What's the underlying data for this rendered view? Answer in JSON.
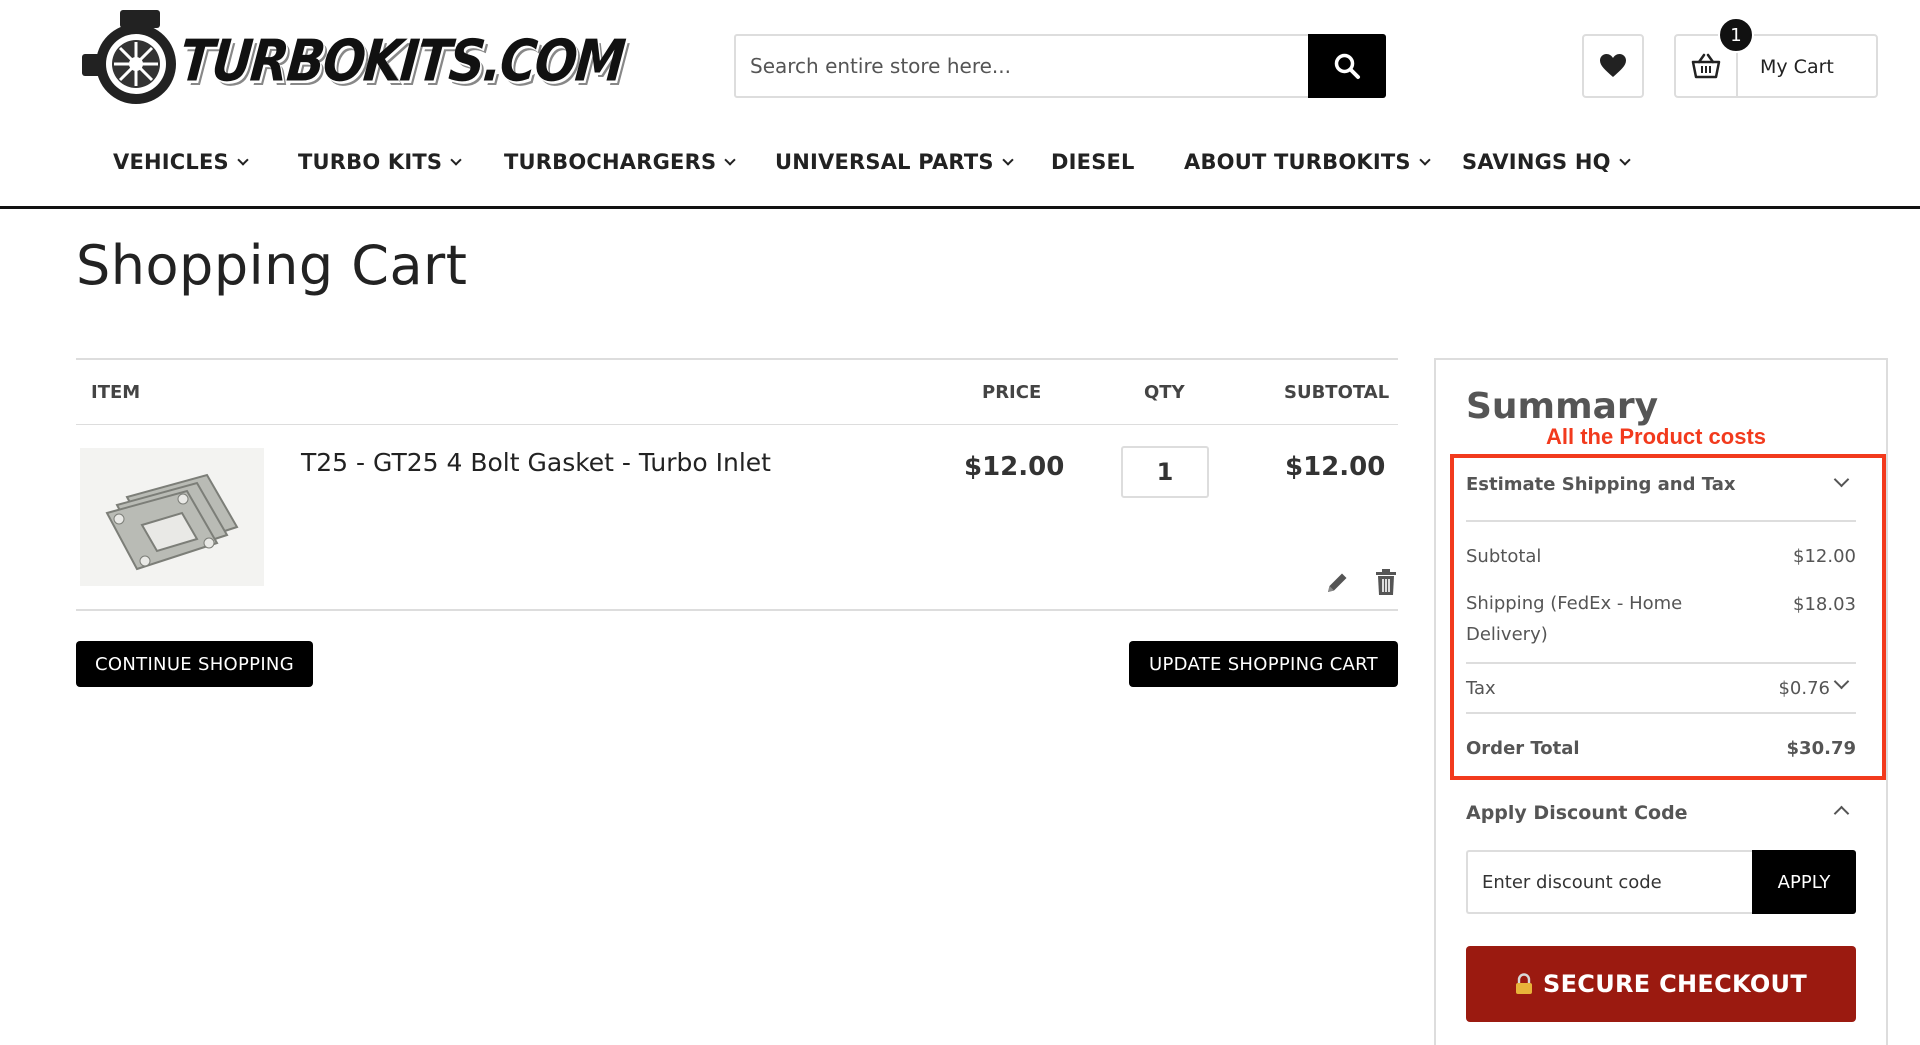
{
  "header": {
    "logo_text": "TURBOKITS.COM",
    "search_placeholder": "Search entire store here...",
    "cart_label": "My Cart",
    "cart_count": "1"
  },
  "nav": {
    "items": [
      {
        "label": "VEHICLES",
        "dropdown": true
      },
      {
        "label": "TURBO KITS",
        "dropdown": true
      },
      {
        "label": "TURBOCHARGERS",
        "dropdown": true
      },
      {
        "label": "UNIVERSAL PARTS",
        "dropdown": true
      },
      {
        "label": "DIESEL",
        "dropdown": false
      },
      {
        "label": "ABOUT TURBOKITS",
        "dropdown": true
      },
      {
        "label": "SAVINGS HQ",
        "dropdown": true
      }
    ]
  },
  "page": {
    "title": "Shopping Cart"
  },
  "cart": {
    "columns": {
      "item": "ITEM",
      "price": "PRICE",
      "qty": "QTY",
      "subtotal": "SUBTOTAL"
    },
    "items": [
      {
        "name": "T25 - GT25 4 Bolt Gasket - Turbo Inlet",
        "price": "$12.00",
        "qty": "1",
        "subtotal": "$12.00"
      }
    ],
    "continue_label": "CONTINUE SHOPPING",
    "update_label": "UPDATE SHOPPING CART"
  },
  "summary": {
    "title": "Summary",
    "annotation": "All the Product costs",
    "estimate_label": "Estimate Shipping and Tax",
    "subtotal_label": "Subtotal",
    "subtotal_value": "$12.00",
    "shipping_label": "Shipping (FedEx - Home Delivery)",
    "shipping_value": "$18.03",
    "tax_label": "Tax",
    "tax_value": "$0.76",
    "order_total_label": "Order Total",
    "order_total_value": "$30.79",
    "discount_label": "Apply Discount Code",
    "discount_placeholder": "Enter discount code",
    "apply_label": "APPLY",
    "checkout_label": "SECURE CHECKOUT"
  },
  "colors": {
    "accent_black": "#000000",
    "checkout_red": "#9b1a10",
    "annotation_red": "#f23a1d",
    "border_gray": "#dddddd"
  },
  "icons": [
    "turbo-logo-icon",
    "search-icon",
    "heart-icon",
    "basket-icon",
    "chevron-down-icon",
    "pencil-icon",
    "trash-icon",
    "chevron-up-icon",
    "lock-icon"
  ]
}
